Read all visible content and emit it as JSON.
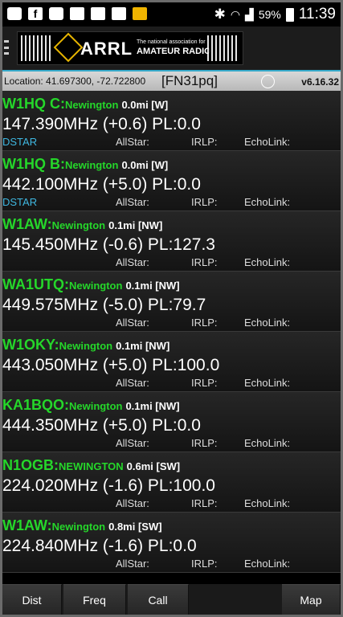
{
  "status": {
    "battery": "59%",
    "clock": "11:39"
  },
  "header": {
    "logo": "ARRL",
    "tagline1": "The national association for",
    "tagline2": "AMATEUR RADIO"
  },
  "location": {
    "text": "Location: 41.697300, -72.722800",
    "grid": "[FN31pq]",
    "version": "v6.16.32"
  },
  "repeaters": [
    {
      "call": "W1HQ   C:",
      "city": "Newington",
      "dist": "0.0mi [W]",
      "freq": "147.390MHz (+0.6) PL:0.0",
      "dstar": "DSTAR",
      "allstar": "AllStar:",
      "irlp": "IRLP:",
      "echolink": "EchoLink:"
    },
    {
      "call": "W1HQ   B:",
      "city": "Newington",
      "dist": "0.0mi [W]",
      "freq": "442.100MHz (+5.0) PL:0.0",
      "dstar": "DSTAR",
      "allstar": "AllStar:",
      "irlp": "IRLP:",
      "echolink": "EchoLink:"
    },
    {
      "call": "W1AW:",
      "city": "Newington",
      "dist": "0.1mi [NW]",
      "freq": "145.450MHz (-0.6) PL:127.3",
      "dstar": "",
      "allstar": "AllStar:",
      "irlp": "IRLP:",
      "echolink": "EchoLink:"
    },
    {
      "call": "WA1UTQ:",
      "city": "Newington",
      "dist": "0.1mi [NW]",
      "freq": "449.575MHz (-5.0) PL:79.7",
      "dstar": "",
      "allstar": "AllStar:",
      "irlp": "IRLP:",
      "echolink": "EchoLink:"
    },
    {
      "call": "W1OKY:",
      "city": "Newington",
      "dist": "0.1mi [NW]",
      "freq": "443.050MHz (+5.0) PL:100.0",
      "dstar": "",
      "allstar": "AllStar:",
      "irlp": "IRLP:",
      "echolink": "EchoLink:"
    },
    {
      "call": "KA1BQO:",
      "city": "Newington",
      "dist": "0.1mi [NW]",
      "freq": "444.350MHz (+5.0) PL:0.0",
      "dstar": "",
      "allstar": "AllStar:",
      "irlp": "IRLP:",
      "echolink": "EchoLink:"
    },
    {
      "call": "N1OGB:",
      "city": "NEWINGTON",
      "dist": "0.6mi [SW]",
      "freq": "224.020MHz (-1.6) PL:100.0",
      "dstar": "",
      "allstar": "AllStar:",
      "irlp": "IRLP:",
      "echolink": "EchoLink:"
    },
    {
      "call": "W1AW:",
      "city": "Newington",
      "dist": "0.8mi [SW]",
      "freq": "224.840MHz (-1.6) PL:0.0",
      "dstar": "",
      "allstar": "AllStar:",
      "irlp": "IRLP:",
      "echolink": "EchoLink:"
    }
  ],
  "toolbar": {
    "dist": "Dist",
    "freq": "Freq",
    "call": "Call",
    "map": "Map"
  },
  "colors": {
    "callsign": "#25d72a",
    "dstar": "#3fb7e0",
    "accent": "#36a9c9"
  }
}
